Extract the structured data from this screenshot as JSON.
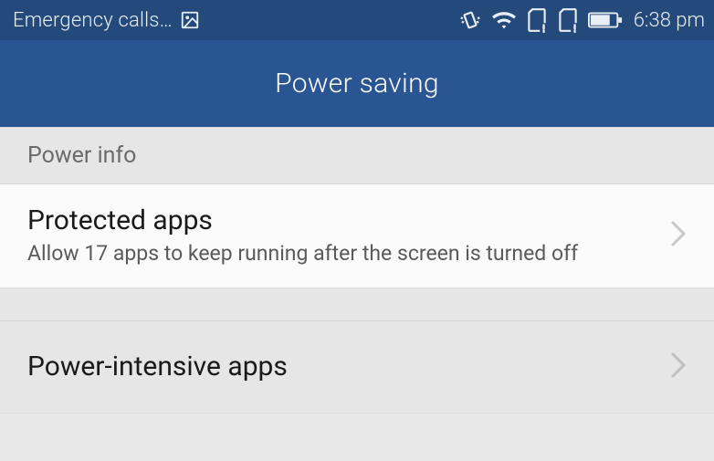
{
  "status": {
    "left_text": "Emergency calls…",
    "time": "6:38 pm"
  },
  "header": {
    "title": "Power saving"
  },
  "section": {
    "label": "Power info"
  },
  "items": {
    "protected": {
      "title": "Protected apps",
      "subtitle": "Allow 17 apps to keep running after the screen is turned off"
    },
    "intensive": {
      "title": "Power-intensive apps"
    }
  }
}
